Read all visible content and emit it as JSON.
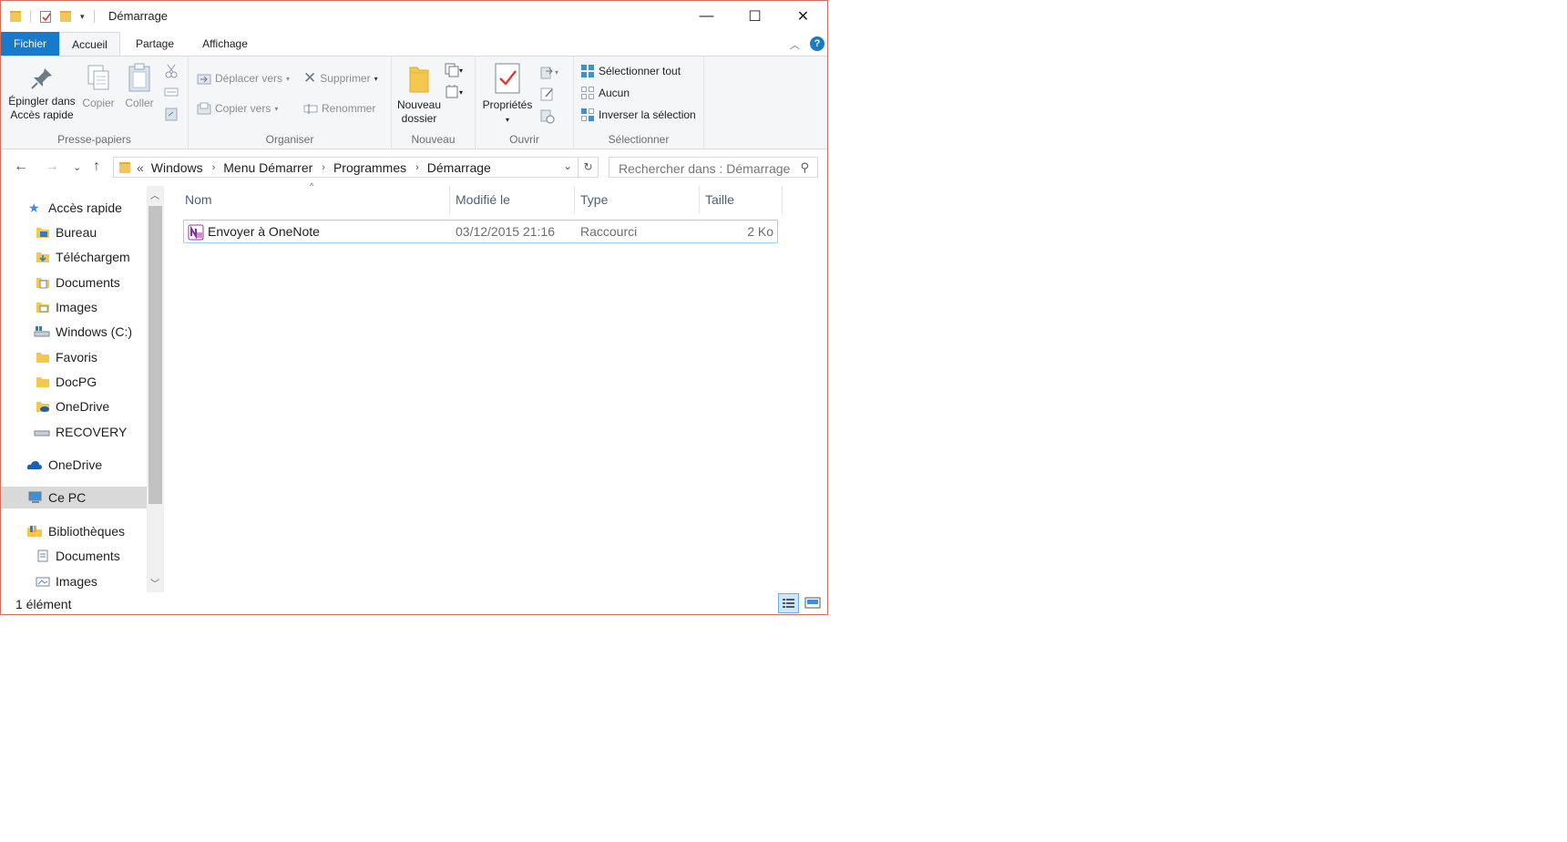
{
  "window": {
    "title": "Démarrage",
    "controls": {
      "minimize": "—",
      "maximize": "☐",
      "close": "✕"
    }
  },
  "tabs": [
    {
      "label": "Fichier"
    },
    {
      "label": "Accueil"
    },
    {
      "label": "Partage"
    },
    {
      "label": "Affichage"
    }
  ],
  "help": "?",
  "ribbon": {
    "clipboard": {
      "label": "Presse-papiers",
      "pin_label_1": "Épingler dans",
      "pin_label_2": "Accès rapide",
      "copy": "Copier",
      "paste": "Coller"
    },
    "organize": {
      "label": "Organiser",
      "move_to": "Déplacer vers",
      "copy_to": "Copier vers",
      "delete": "Supprimer",
      "rename": "Renommer"
    },
    "new": {
      "label": "Nouveau",
      "new_folder_1": "Nouveau",
      "new_folder_2": "dossier"
    },
    "open": {
      "label": "Ouvrir",
      "properties": "Propriétés"
    },
    "select": {
      "label": "Sélectionner",
      "select_all": "Sélectionner tout",
      "select_none": "Aucun",
      "invert": "Inverser la sélection"
    }
  },
  "address": {
    "prefix": "«",
    "crumbs": [
      "Windows",
      "Menu Démarrer",
      "Programmes",
      "Démarrage"
    ]
  },
  "search": {
    "placeholder": "Rechercher dans : Démarrage"
  },
  "nav": {
    "quick_access": "Accès rapide",
    "items": [
      {
        "label": "Bureau",
        "pinned": true
      },
      {
        "label": "Téléchargeme",
        "pinned": true
      },
      {
        "label": "Documents",
        "pinned": true
      },
      {
        "label": "Images",
        "pinned": true
      },
      {
        "label": "Windows (C:)",
        "pinned": true
      },
      {
        "label": "Favoris",
        "pinned": true
      },
      {
        "label": "DocPG",
        "pinned": true
      },
      {
        "label": "OneDrive",
        "pinned": true
      },
      {
        "label": "RECOVERY (D",
        "pinned": true
      }
    ],
    "onedrive": "OneDrive",
    "this_pc": "Ce PC",
    "libraries": "Bibliothèques",
    "lib_items": [
      "Documents",
      "Images"
    ]
  },
  "columns": {
    "name": "Nom",
    "modified": "Modifié le",
    "type": "Type",
    "size": "Taille"
  },
  "files": [
    {
      "name": "Envoyer à OneNote",
      "modified": "03/12/2015 21:16",
      "type": "Raccourci",
      "size": "2 Ko"
    }
  ],
  "status": {
    "count": "1 élément"
  },
  "colors": {
    "accent": "#1979ca",
    "window_border": "#d26e61",
    "selection_border": "#99d1ff"
  }
}
